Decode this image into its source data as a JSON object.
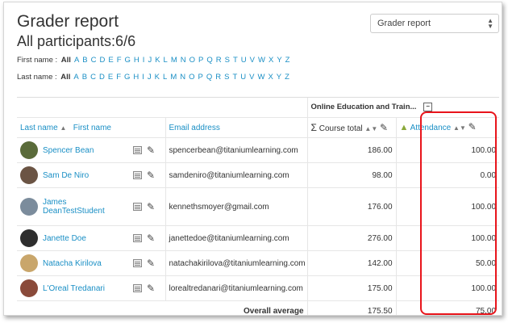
{
  "page": {
    "title": "Grader report",
    "subtitle": "All participants:6/6",
    "report_select": "Grader report"
  },
  "filters": {
    "first_name_label": "First name :",
    "last_name_label": "Last name :",
    "letters": [
      "All",
      "A",
      "B",
      "C",
      "D",
      "E",
      "F",
      "G",
      "H",
      "I",
      "J",
      "K",
      "L",
      "M",
      "N",
      "O",
      "P",
      "Q",
      "R",
      "S",
      "T",
      "U",
      "V",
      "W",
      "X",
      "Y",
      "Z"
    ]
  },
  "category": {
    "name": "Online Education and Train..."
  },
  "columns": {
    "last_name": "Last name",
    "first_name": "First name",
    "email": "Email address",
    "course_total": "Course total",
    "attendance": "Attendance"
  },
  "rows": [
    {
      "name": "Spencer Bean",
      "name2": "",
      "email": "spencerbean@titaniumlearning.com",
      "course_total": "186.00",
      "attendance": "100.00",
      "avatar_color": "#5a6b3a"
    },
    {
      "name": "Sam De Niro",
      "name2": "",
      "email": "samdeniro@titaniumlearning.com",
      "course_total": "98.00",
      "attendance": "0.00",
      "avatar_color": "#6b5444"
    },
    {
      "name": "James",
      "name2": "DeanTestStudent",
      "email": "kennethsmoyer@gmail.com",
      "course_total": "176.00",
      "attendance": "100.00",
      "avatar_color": "#7b8c9c"
    },
    {
      "name": "Janette Doe",
      "name2": "",
      "email": "janettedoe@titaniumlearning.com",
      "course_total": "276.00",
      "attendance": "100.00",
      "avatar_color": "#2e2e2e"
    },
    {
      "name": "Natacha Kirilova",
      "name2": "",
      "email": "natachakirilova@titaniumlearning.com",
      "course_total": "142.00",
      "attendance": "50.00",
      "avatar_color": "#c9a66b"
    },
    {
      "name": "L'Oreal Tredanari",
      "name2": "",
      "email": "lorealtredanari@titaniumlearning.com",
      "course_total": "175.00",
      "attendance": "100.00",
      "avatar_color": "#8a4a3a"
    }
  ],
  "average": {
    "label": "Overall average",
    "course_total": "175.50",
    "attendance": "75.00"
  },
  "colors": {
    "link": "#1a8fc5",
    "highlight": "#e8141b"
  }
}
